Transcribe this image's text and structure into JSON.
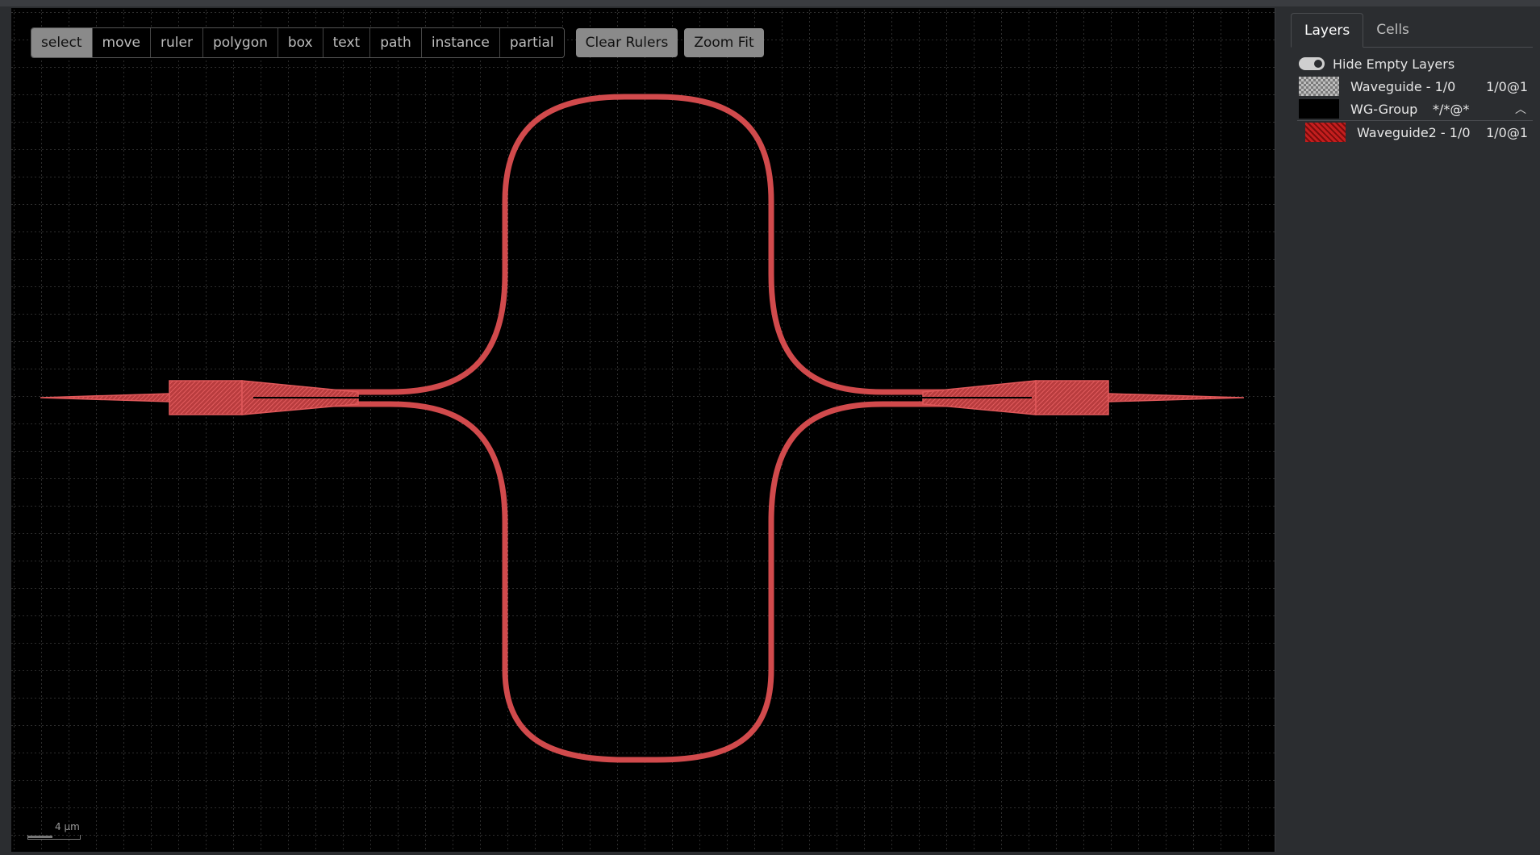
{
  "toolbar": {
    "tools": [
      "select",
      "move",
      "ruler",
      "polygon",
      "box",
      "text",
      "path",
      "instance",
      "partial"
    ],
    "active_tool": "select",
    "clear_rulers": "Clear Rulers",
    "zoom_fit": "Zoom Fit"
  },
  "scale": {
    "label": "4 μm"
  },
  "sidebar": {
    "tabs": [
      "Layers",
      "Cells"
    ],
    "hide_empty": "Hide Empty Layers",
    "layers": [
      {
        "name": "Waveguide - 1/0",
        "spec": "1/0@1"
      }
    ],
    "group": {
      "name": "WG-Group",
      "spec": "*/*@*"
    },
    "group_layers": [
      {
        "name": "Waveguide2 - 1/0",
        "spec": "1/0@1"
      }
    ]
  },
  "colors": {
    "waveguide": "#e0585a",
    "canvas": "#000000",
    "panel": "#2b2d30"
  }
}
